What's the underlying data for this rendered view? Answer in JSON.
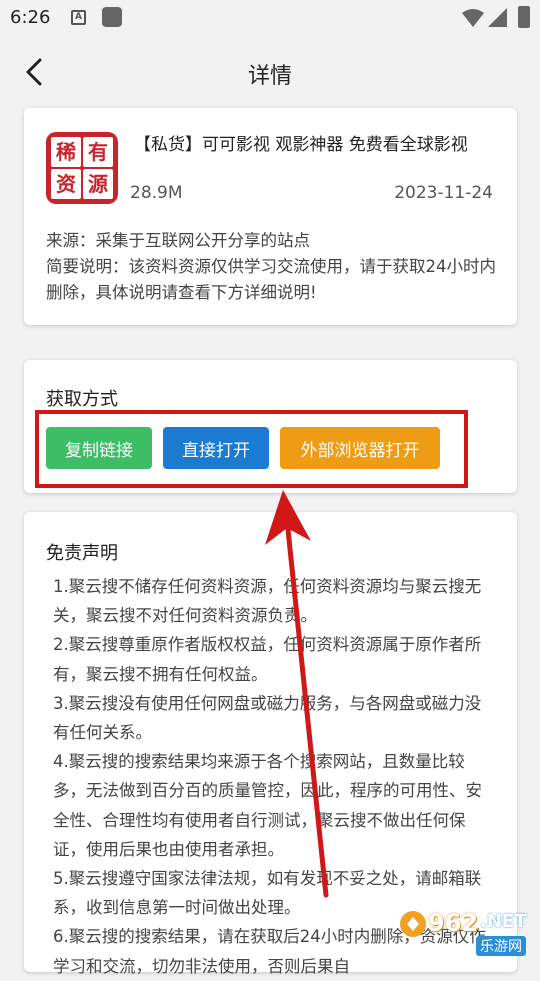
{
  "status_bar": {
    "time": "6:26",
    "notif_letter": "A"
  },
  "header": {
    "title": "详情"
  },
  "app": {
    "name": "【私货】可可影视 观影神器 免费看全球影视",
    "size": "28.9M",
    "date": "2023-11-24",
    "logo_chars": [
      "稀",
      "有",
      "资",
      "源"
    ],
    "source": "来源：采集于互联网公开分享的站点",
    "note": "简要说明：该资料资源仅供学习交流使用，请于获取24小时内删除，具体说明请查看下方详细说明!"
  },
  "access": {
    "title": "获取方式",
    "copy_label": "复制链接",
    "open_label": "直接打开",
    "external_label": "外部浏览器打开"
  },
  "disclaimer": {
    "title": "免责声明",
    "items": [
      "1.聚云搜不储存任何资料资源，任何资料资源均与聚云搜无关，聚云搜不对任何资料资源负责。",
      "2.聚云搜尊重原作者版权权益，任何资料资源属于原作者所有，聚云搜不拥有任何权益。",
      "3.聚云搜没有使用任何网盘或磁力服务，与各网盘或磁力没有任何关系。",
      "4.聚云搜的搜索结果均来源于各个搜索网站，且数量比较多，无法做到百分百的质量管控，因此，程序的可用性、安全性、合理性均有使用者自行测试，聚云搜不做出任何保证，使用后果也由使用者承担。",
      "5.聚云搜遵守国家法律法规，如有发现不妥之处，请邮箱联系，收到信息第一时间做出处理。",
      "6.聚云搜的搜索结果，请在获取后24小时内删除，资源仅作学习和交流，切勿非法使用，否则后果自"
    ]
  },
  "watermark": {
    "number": "962",
    "net": ".NET",
    "cn": "乐游网"
  },
  "colors": {
    "copy": "#3ebd67",
    "open": "#1a7bd1",
    "external": "#ef9c15",
    "highlight": "#d01818",
    "logo": "#c8252b"
  }
}
